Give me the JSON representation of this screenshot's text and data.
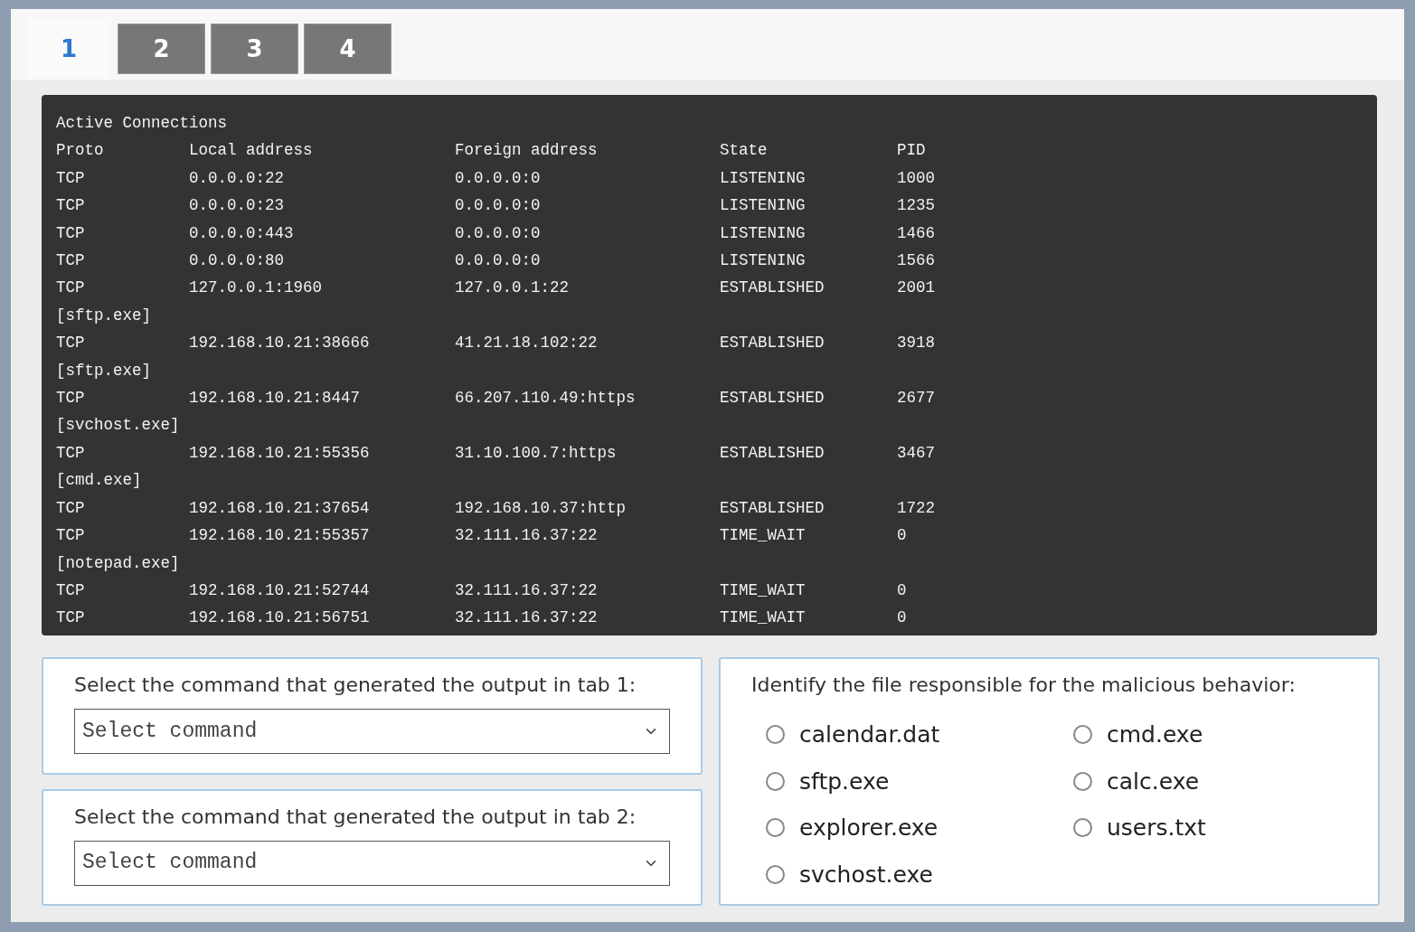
{
  "tabs": [
    {
      "label": "1",
      "selected": true
    },
    {
      "label": "2",
      "selected": false
    },
    {
      "label": "3",
      "selected": false
    },
    {
      "label": "4",
      "selected": false
    }
  ],
  "terminal": {
    "title": "Active Connections",
    "columns": [
      "Proto",
      "Local address",
      "Foreign address",
      "State",
      "PID"
    ],
    "rows": [
      {
        "kind": "connection",
        "cells": [
          "TCP",
          "0.0.0.0:22",
          "0.0.0.0:0",
          "LISTENING",
          "1000"
        ]
      },
      {
        "kind": "connection",
        "cells": [
          "TCP",
          "0.0.0.0:23",
          "0.0.0.0:0",
          "LISTENING",
          "1235"
        ]
      },
      {
        "kind": "connection",
        "cells": [
          "TCP",
          "0.0.0.0:443",
          "0.0.0.0:0",
          "LISTENING",
          "1466"
        ]
      },
      {
        "kind": "connection",
        "cells": [
          "TCP",
          "0.0.0.0:80",
          "0.0.0.0:0",
          "LISTENING",
          "1566"
        ]
      },
      {
        "kind": "connection",
        "cells": [
          "TCP",
          "127.0.0.1:1960",
          "127.0.0.1:22",
          "ESTABLISHED",
          "2001"
        ]
      },
      {
        "kind": "process",
        "text": "[sftp.exe]"
      },
      {
        "kind": "connection",
        "cells": [
          "TCP",
          "192.168.10.21:38666",
          "41.21.18.102:22",
          "ESTABLISHED",
          "3918"
        ]
      },
      {
        "kind": "process",
        "text": "[sftp.exe]"
      },
      {
        "kind": "connection",
        "cells": [
          "TCP",
          "192.168.10.21:8447",
          "66.207.110.49:https",
          "ESTABLISHED",
          "2677"
        ]
      },
      {
        "kind": "process",
        "text": "[svchost.exe]"
      },
      {
        "kind": "connection",
        "cells": [
          "TCP",
          "192.168.10.21:55356",
          "31.10.100.7:https",
          "ESTABLISHED",
          "3467"
        ]
      },
      {
        "kind": "process",
        "text": "[cmd.exe]"
      },
      {
        "kind": "connection",
        "cells": [
          "TCP",
          "192.168.10.21:37654",
          "192.168.10.37:http",
          "ESTABLISHED",
          "1722"
        ]
      },
      {
        "kind": "connection",
        "cells": [
          "TCP",
          "192.168.10.21:55357",
          "32.111.16.37:22",
          "TIME_WAIT",
          "0"
        ]
      },
      {
        "kind": "process",
        "text": "[notepad.exe]"
      },
      {
        "kind": "connection",
        "cells": [
          "TCP",
          "192.168.10.21:52744",
          "32.111.16.37:22",
          "TIME_WAIT",
          "0"
        ]
      },
      {
        "kind": "connection",
        "cells": [
          "TCP",
          "192.168.10.21:56751",
          "32.111.16.37:22",
          "TIME_WAIT",
          "0"
        ]
      }
    ]
  },
  "questions": [
    {
      "prompt": "Select the command that generated the output in tab 1:",
      "select": {
        "value": "Select command"
      }
    },
    {
      "prompt": "Select the command that generated the output in tab 2:",
      "select": {
        "value": "Select command"
      }
    }
  ],
  "file_question": {
    "prompt": "Identify the file responsible for the malicious behavior:",
    "options": [
      {
        "label": "calendar.dat",
        "selected": false
      },
      {
        "label": "cmd.exe",
        "selected": false
      },
      {
        "label": "sftp.exe",
        "selected": false
      },
      {
        "label": "calc.exe",
        "selected": false
      },
      {
        "label": "explorer.exe",
        "selected": false
      },
      {
        "label": "users.txt",
        "selected": false
      },
      {
        "label": "svchost.exe",
        "selected": false
      }
    ]
  }
}
